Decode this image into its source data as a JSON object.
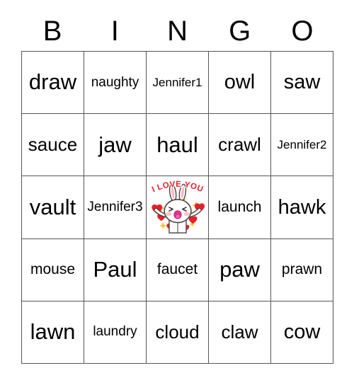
{
  "header": {
    "letters": [
      "B",
      "I",
      "N",
      "G",
      "O"
    ]
  },
  "grid": {
    "rows": [
      [
        {
          "text": "draw",
          "size": "s-xl"
        },
        {
          "text": "naughty",
          "size": "s-xs"
        },
        {
          "text": "Jennifer1",
          "size": "s-xxs"
        },
        {
          "text": "owl",
          "size": "s-lg"
        },
        {
          "text": "saw",
          "size": "s-lg"
        }
      ],
      [
        {
          "text": "sauce",
          "size": "s-md"
        },
        {
          "text": "jaw",
          "size": "s-xl"
        },
        {
          "text": "haul",
          "size": "s-xl"
        },
        {
          "text": "crawl",
          "size": "s-md"
        },
        {
          "text": "Jennifer2",
          "size": "s-xxs"
        }
      ],
      [
        {
          "text": "vault",
          "size": "s-xl"
        },
        {
          "text": "Jennifer3",
          "size": "s-xs"
        },
        {
          "text": "",
          "size": "free",
          "image": "i-love-you-bunny-sticker"
        },
        {
          "text": "launch",
          "size": "s-sm"
        },
        {
          "text": "hawk",
          "size": "s-lg"
        }
      ],
      [
        {
          "text": "mouse",
          "size": "s-sm"
        },
        {
          "text": "Paul",
          "size": "s-xl"
        },
        {
          "text": "faucet",
          "size": "s-sm"
        },
        {
          "text": "paw",
          "size": "s-xl"
        },
        {
          "text": "prawn",
          "size": "s-sm"
        }
      ],
      [
        {
          "text": "lawn",
          "size": "s-xl"
        },
        {
          "text": "laundry",
          "size": "s-xs"
        },
        {
          "text": "cloud",
          "size": "s-md"
        },
        {
          "text": "claw",
          "size": "s-md"
        },
        {
          "text": "cow",
          "size": "s-lg"
        }
      ]
    ]
  },
  "free_space": {
    "caption": "I LOVE YOU",
    "caption_color": "#e8202a",
    "heart_color": "#e8202a",
    "sparkle_color": "#f6c945",
    "character_fill": "#ffffff",
    "character_outline": "#4a3f3a",
    "ear_inner_color": "#f7b8c6",
    "cheek_color": "#f9c3cd",
    "mouth_color": "#e8318f"
  },
  "colors": {
    "grid_line": "#555555",
    "text": "#000000",
    "background": "#ffffff"
  }
}
